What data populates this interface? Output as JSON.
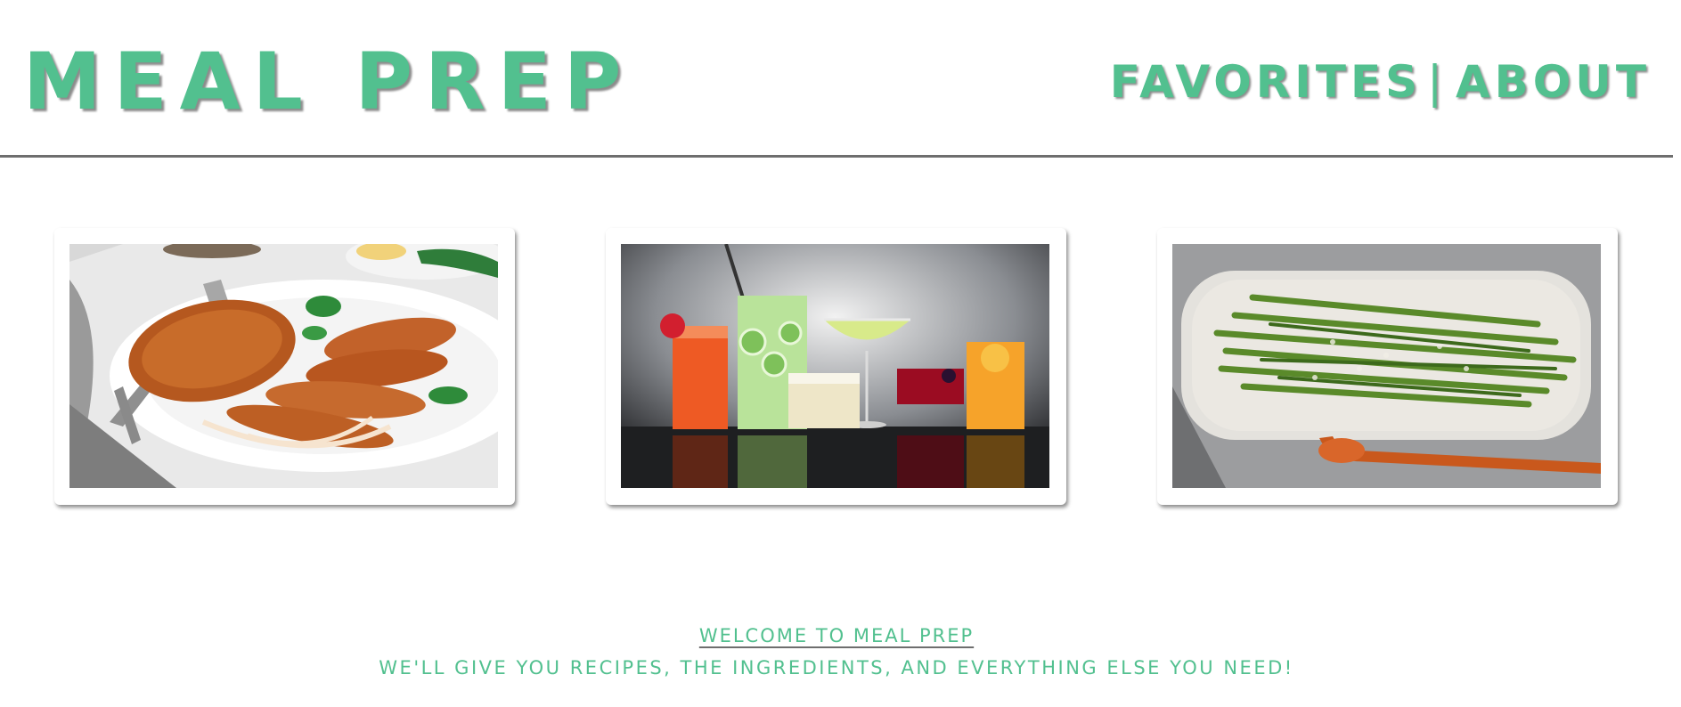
{
  "header": {
    "brand": "MEAL PREP",
    "nav": {
      "favorites": "FAVORITES",
      "separator": "|",
      "about": "ABOUT"
    }
  },
  "gallery": [
    {
      "subject": "sliced grilled chicken breast on a white plate with fork and parsley"
    },
    {
      "subject": "assorted colorful drinks and cocktails in glasses"
    },
    {
      "subject": "grilled asparagus on an oval platter with a wooden spoon"
    }
  ],
  "intro": {
    "heading": "WELCOME TO MEAL PREP",
    "tagline": "WE'LL GIVE YOU RECIPES, THE INGREDIENTS, AND EVERYTHING ELSE YOU NEED!"
  },
  "colors": {
    "accent": "#52c08f",
    "rule": "#6e6e6e",
    "background": "#ffffff"
  }
}
